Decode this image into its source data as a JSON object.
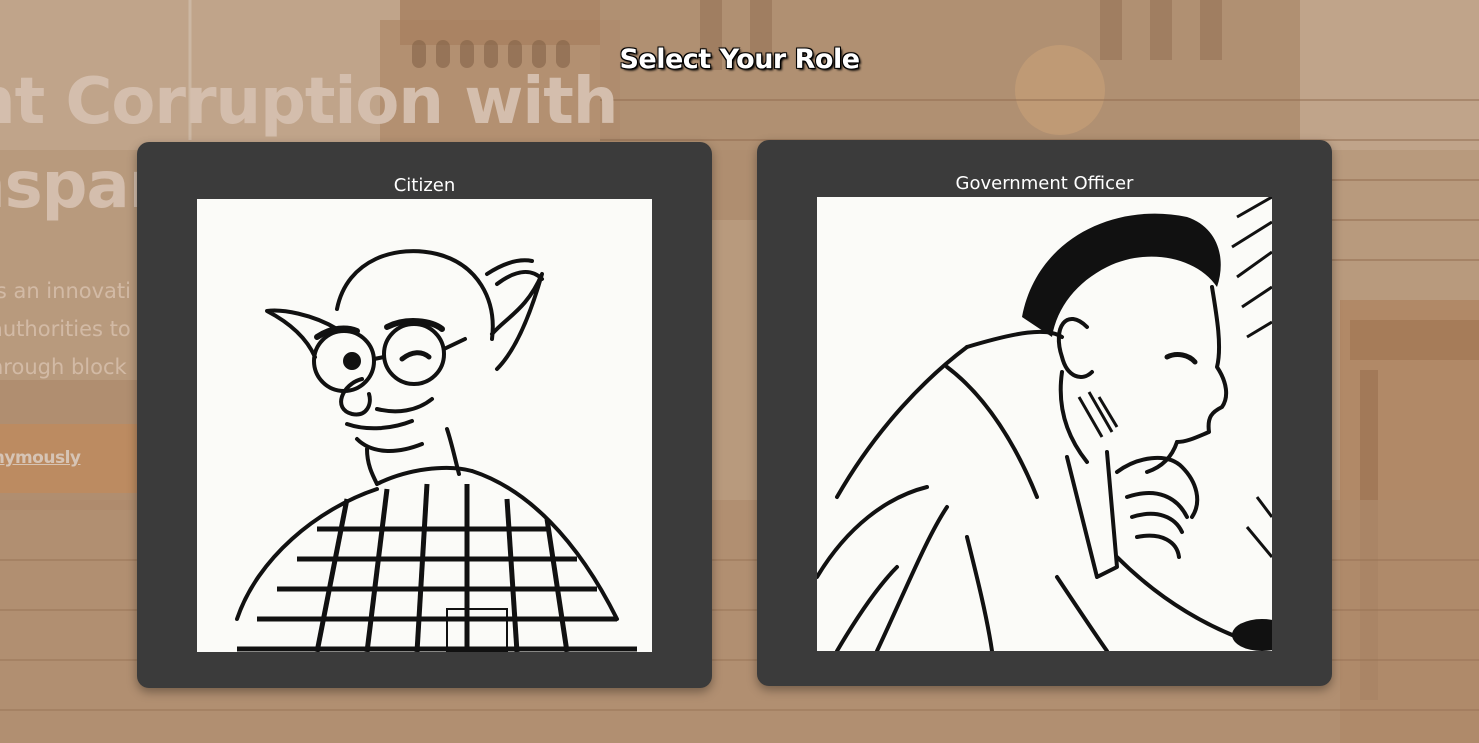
{
  "hero": {
    "title_line1": "nt Corruption with",
    "title_line2": "nspar",
    "description": [
      "is an innovati",
      " authorities to",
      "hrough block"
    ],
    "cta_label": "nonymously"
  },
  "role_modal": {
    "title": "Select Your Role",
    "roles": [
      {
        "label": "Citizen",
        "icon": "citizen-caricature"
      },
      {
        "label": "Government Officer",
        "icon": "officer-caricature"
      }
    ]
  },
  "colors": {
    "card_bg": "#3b3b3b",
    "hero_text": "#f6dfcc",
    "cta_bg": "#d8a070"
  }
}
